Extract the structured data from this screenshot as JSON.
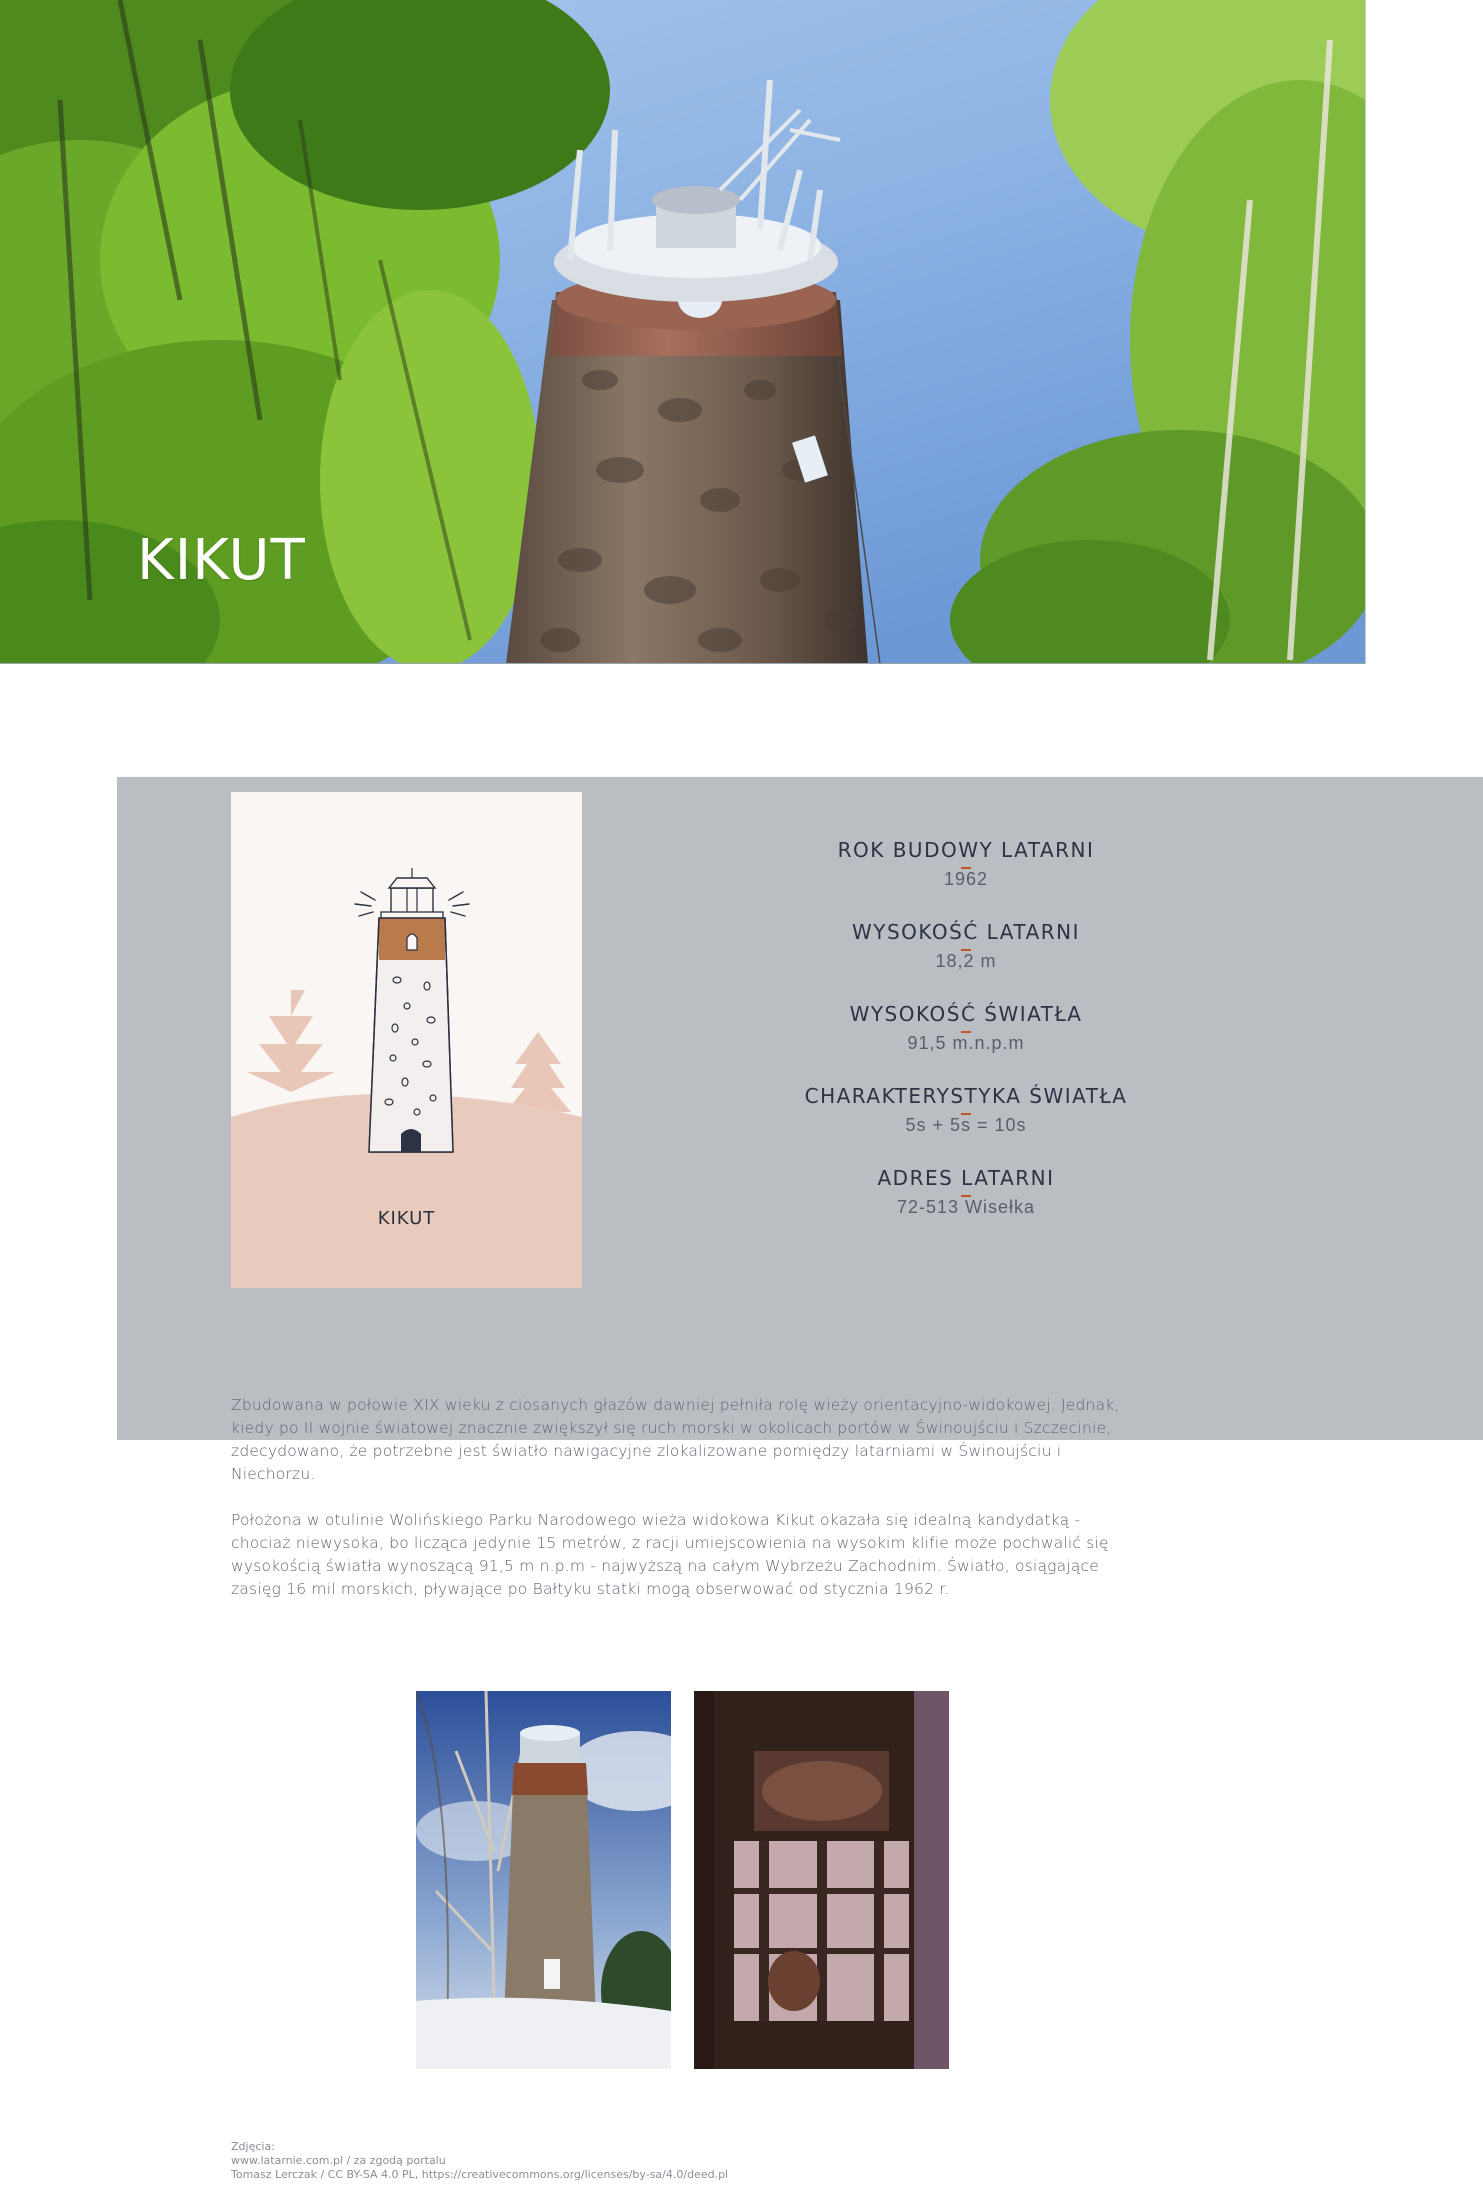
{
  "hero": {
    "title": "KIKUT"
  },
  "card": {
    "label": "KIKUT"
  },
  "facts": [
    {
      "label": "ROK BUDOWY LATARNI",
      "value": "1962"
    },
    {
      "label": "WYSOKOŚĆ LATARNI",
      "value": "18,2 m"
    },
    {
      "label": "WYSOKOŚĆ ŚWIATŁA",
      "value": "91,5 m.n.p.m"
    },
    {
      "label": "CHARAKTERYSTYKA ŚWIATŁA",
      "value": "5s + 5s = 10s"
    },
    {
      "label": "ADRES LATARNI",
      "value": "72-513 Wisełka"
    }
  ],
  "description": {
    "p1": "Zbudowana w połowie XIX wieku z ciosanych głazów dawniej pełniła rolę wieży orientacyjno-widokowej. Jednak, kiedy po II wojnie światowej znacznie zwiększył się ruch morski w okolicach portów w Świnoujściu i Szczecinie, zdecydowano, że potrzebne jest światło nawigacyjne zlokalizowane pomiędzy latarniami w Świnoujściu i Niechorzu.",
    "p2": "Położona w otulinie Wolińskiego Parku Narodowego wieża widokowa Kikut okazała się idealną kandydatką - chociaż niewysoka, bo licząca jedynie 15 metrów, z racji umiejscowienia na wysokim klifie może pochwalić się wysokością światła wynoszącą 91,5 m n.p.m - najwyższą na całym Wybrzeżu Zachodnim. Światło, osiągające zasięg 16 mil morskich, pływające po Bałtyku statki mogą obserwować od stycznia 1962 r."
  },
  "credits": {
    "line1": "Zdjęcia:",
    "line2": "www.latarnie.com.pl / za zgodą portalu",
    "line3": "Tomasz Lerczak / CC BY-SA 4.0 PL, https://creativecommons.org/licenses/by-sa/4.0/deed.pl"
  },
  "colors": {
    "band": "#babdc2",
    "accent": "#c0562e",
    "card_bg": "#f9f6f4",
    "card_hill": "#e9cbbd",
    "tower_top": "#b97a4c"
  }
}
